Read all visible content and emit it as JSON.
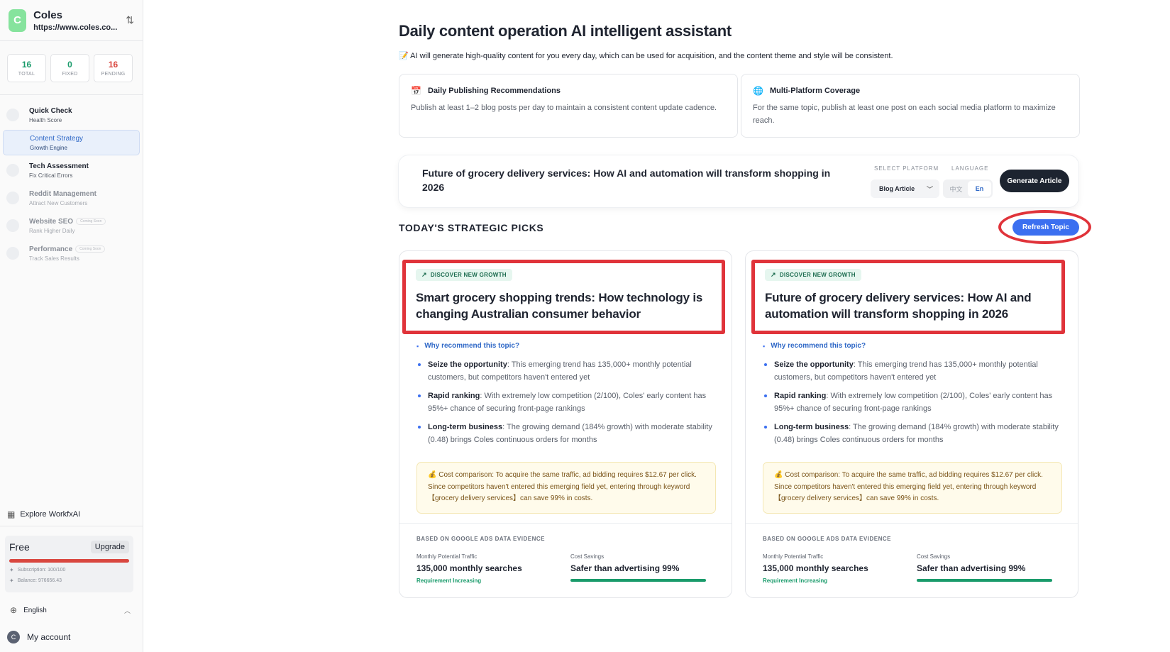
{
  "brand": {
    "initial": "C",
    "name": "Coles",
    "url": "https://www.coles.co..."
  },
  "stats": [
    {
      "value": "16",
      "label": "TOTAL"
    },
    {
      "value": "0",
      "label": "FIXED"
    },
    {
      "value": "16",
      "label": "PENDING"
    }
  ],
  "nav": [
    {
      "title": "Quick Check",
      "subtitle": "Health Score",
      "badge": ""
    },
    {
      "title": "Content Strategy",
      "subtitle": "Growth Engine",
      "badge": ""
    },
    {
      "title": "Tech Assessment",
      "subtitle": "Fix Critical Errors",
      "badge": ""
    },
    {
      "title": "Reddit Management",
      "subtitle": "Attract New Customers",
      "badge": ""
    },
    {
      "title": "Website SEO",
      "subtitle": "Rank Higher Daily",
      "badge": "Coming Soon"
    },
    {
      "title": "Performance",
      "subtitle": "Track Sales Results",
      "badge": "Coming Soon"
    }
  ],
  "explore_label": "Explore WorkfxAI",
  "plan": {
    "name": "Free",
    "upgrade_label": "Upgrade",
    "usage_fraction": 1.0,
    "subscription": "Subscription: 100/100",
    "balance": "Balance: 976656.43"
  },
  "language": "English",
  "account_label": "My account",
  "account_initial": "C",
  "page": {
    "title": "Daily content operation AI intelligent assistant",
    "description_icon": "📝",
    "description": "AI will generate high-quality content for you every day, which can be used for acquisition, and the content theme and style will be consistent."
  },
  "recommendations": [
    {
      "icon": "📅",
      "title": "Daily Publishing Recommendations",
      "text": "Publish at least 1–2 blog posts per day to maintain a consistent content update cadence."
    },
    {
      "icon": "🌐",
      "title": "Multi-Platform Coverage",
      "text": "For the same topic, publish at least one post on each social media platform to maximize reach."
    }
  ],
  "topic_bar": {
    "topic": "Future of grocery delivery services: How AI and automation will transform shopping in 2026",
    "platform_label": "SELECT PLATFORM",
    "platform_value": "Blog Article",
    "language_label": "LANGUAGE",
    "lang_options": [
      "中文",
      "En"
    ],
    "lang_selected": "En",
    "generate_label": "Generate Article"
  },
  "section": {
    "title": "TODAY'S STRATEGIC PICKS",
    "refresh_label": "Refresh Topic"
  },
  "picks": [
    {
      "badge": "DISCOVER NEW GROWTH",
      "title": "Smart grocery shopping trends: How technology is changing Australian consumer behavior",
      "why_label": "Why recommend this topic?",
      "reasons": [
        {
          "head": "Seize the opportunity",
          "text": ": This emerging trend has 135,000+ monthly potential customers, but competitors haven't entered yet"
        },
        {
          "head": "Rapid ranking",
          "text": ": With extremely low competition (2/100), Coles' early content has 95%+ chance of securing front-page rankings"
        },
        {
          "head": "Long-term business",
          "text": ": The growing demand (184% growth) with moderate stability (0.48) brings Coles continuous orders for months"
        }
      ],
      "cost": "💰 Cost comparison: To acquire the same traffic, ad bidding requires $12.67 per click. Since competitors haven't entered this emerging field yet, entering through keyword 【grocery delivery services】can save 99% in costs.",
      "evidence_label": "BASED ON GOOGLE ADS DATA EVIDENCE",
      "traffic_label": "Monthly Potential Traffic",
      "traffic_value": "135,000 monthly searches",
      "traffic_note": "Requirement Increasing",
      "savings_label": "Cost Savings",
      "savings_value": "Safer than advertising 99%",
      "savings_fraction": 0.99
    },
    {
      "badge": "DISCOVER NEW GROWTH",
      "title": "Future of grocery delivery services: How AI and automation will transform shopping in 2026",
      "why_label": "Why recommend this topic?",
      "reasons": [
        {
          "head": "Seize the opportunity",
          "text": ": This emerging trend has 135,000+ monthly potential customers, but competitors haven't entered yet"
        },
        {
          "head": "Rapid ranking",
          "text": ": With extremely low competition (2/100), Coles' early content has 95%+ chance of securing front-page rankings"
        },
        {
          "head": "Long-term business",
          "text": ": The growing demand (184% growth) with moderate stability (0.48) brings Coles continuous orders for months"
        }
      ],
      "cost": "💰 Cost comparison: To acquire the same traffic, ad bidding requires $12.67 per click. Since competitors haven't entered this emerging field yet, entering through keyword 【grocery delivery services】can save 99% in costs.",
      "evidence_label": "BASED ON GOOGLE ADS DATA EVIDENCE",
      "traffic_label": "Monthly Potential Traffic",
      "traffic_value": "135,000 monthly searches",
      "traffic_note": "Requirement Increasing",
      "savings_label": "Cost Savings",
      "savings_value": "Safer than advertising 99%",
      "savings_fraction": 0.99
    }
  ]
}
